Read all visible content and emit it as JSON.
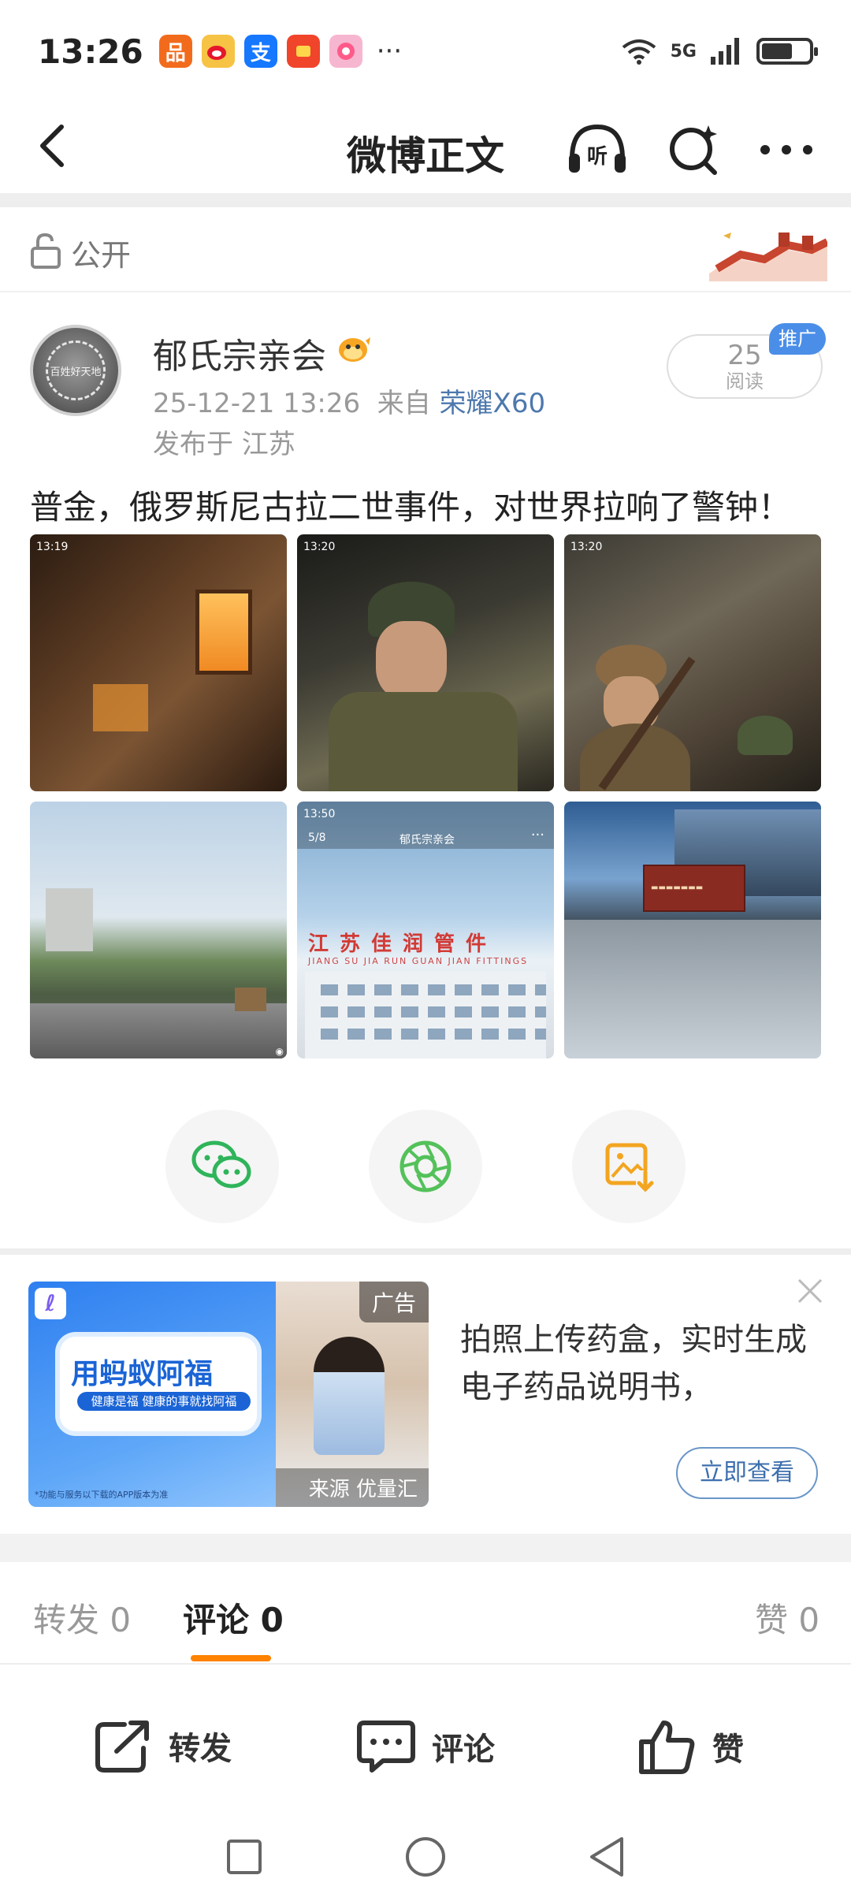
{
  "status_bar": {
    "time": "13:26",
    "network": "5G",
    "app_icons": [
      {
        "name": "app-icon-orange",
        "color": "#f26b1d"
      },
      {
        "name": "weibo-icon",
        "color": "#e8a317"
      },
      {
        "name": "alipay-icon",
        "color": "#1677ff"
      },
      {
        "name": "app-icon-red-orange",
        "color": "#f0442b"
      },
      {
        "name": "app-icon-pink",
        "color": "#f56aa1"
      }
    ]
  },
  "header": {
    "title": "微博正文"
  },
  "visibility": {
    "label": "公开"
  },
  "author": {
    "name": "郁氏宗亲会",
    "avatar_text": "百姓好天地",
    "date": "25-12-21 13:26",
    "source_prefix": "来自",
    "device": "荣耀X60",
    "location": "发布于 江苏"
  },
  "reads": {
    "count": "25",
    "label": "阅读",
    "promo": "推广"
  },
  "post": {
    "text": "普金，俄罗斯尼古拉二世事件，对世界拉响了警钟！"
  },
  "images": {
    "img1_time": "13:19",
    "img2_time": "13:20",
    "img3_time": "13:20",
    "img5_time": "13:50",
    "img5_page": "5/8",
    "img5_account": "郁氏宗亲会",
    "img5_sign": "江苏佳润管件",
    "img5_sign_sub": "JIANG SU JIA RUN GUAN JIAN FITTINGS"
  },
  "ad": {
    "badge": "广告",
    "source": "来源 优量汇",
    "brand": "用蚂蚁阿福",
    "slogan": "健康是福 健康的事就找阿福",
    "footnote": "*功能与服务以下载的APP版本为准",
    "text": "拍照上传药盒，实时生成电子药品说明书，",
    "cta": "立即查看"
  },
  "tabs": {
    "repost": "转发 0",
    "comment": "评论 0",
    "like": "赞 0"
  },
  "actions": {
    "repost": "转发",
    "comment": "评论",
    "like": "赞"
  },
  "colors": {
    "accent": "#ff8200",
    "link": "#4d78ad",
    "wechat": "#2fb45a",
    "moments": "#54c15a",
    "save": "#f3a521"
  }
}
